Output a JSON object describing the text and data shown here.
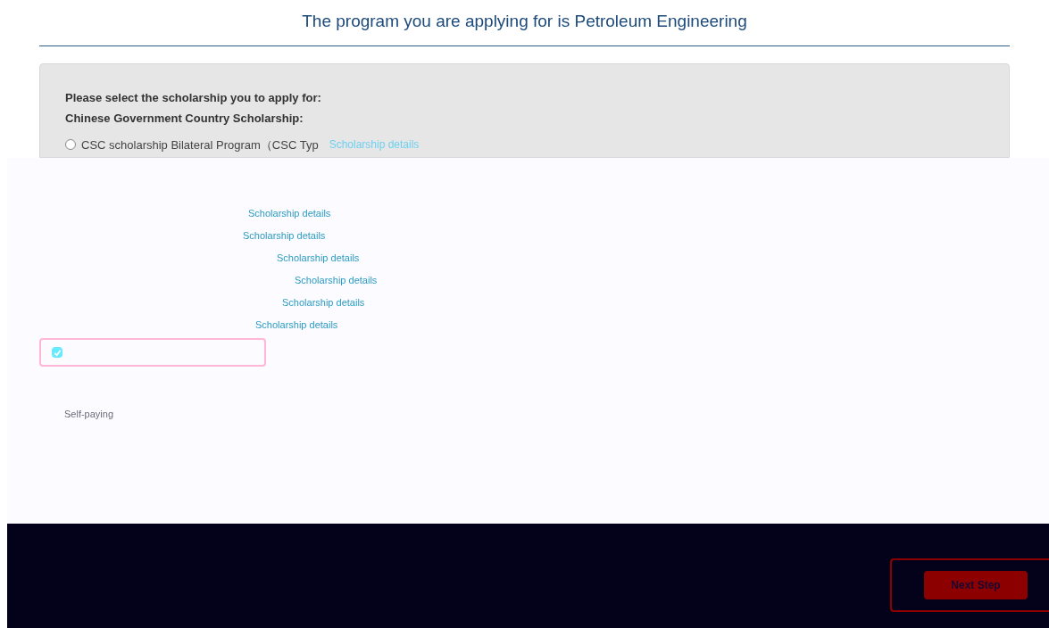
{
  "header": {
    "title": "The program you are applying for is Petroleum Engineering"
  },
  "scholarship_form": {
    "prompt": "Please select the scholarship you to apply for:",
    "group_title": "Chinese Government Country Scholarship:",
    "options": [
      {
        "kind": "radio",
        "label": "CSC scholarship Bilateral Program（CSC Typ",
        "selected": false,
        "link": "Scholarship details"
      }
    ]
  },
  "detail_links": [
    "Scholarship details",
    "Scholarship details",
    "Scholarship details",
    "Scholarship details",
    "Scholarship details",
    "Scholarship details"
  ],
  "confirmation": {
    "checked": true
  },
  "self_paying": {
    "label": "Self-paying"
  },
  "actions": {
    "next": "Next Step"
  }
}
